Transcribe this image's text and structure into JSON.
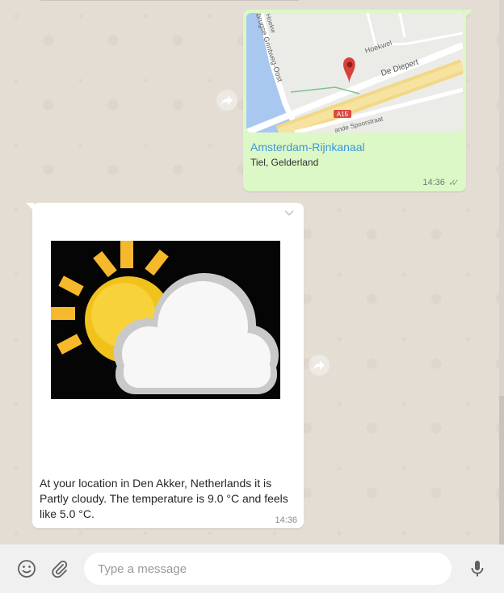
{
  "messages": {
    "location": {
      "name": "Amsterdam-Rijnkanaal",
      "subtitle": "Tiel, Gelderland",
      "time": "14:36",
      "map": {
        "road_hoekwel": "Hoekwel",
        "road_diepert": "De Diepert",
        "road_grintweg": "brugse Grintweg-Oost",
        "road_spoor": "ande Spoorstraat",
        "road_a15": "A15",
        "road_top": "Hoekw"
      }
    },
    "weather": {
      "caption": "At your location in Den Akker, Netherlands it is Partly cloudy. The temperature is 9.0 °C and feels like 5.0 °C.",
      "time": "14:36"
    }
  },
  "composer": {
    "placeholder": "Type a message"
  },
  "icons": {
    "emoji": "smiley-icon",
    "attach": "paperclip-icon",
    "mic": "microphone-icon",
    "forward": "forward-arrow-icon",
    "menu": "chevron-down-icon",
    "ticks": "double-check-icon"
  },
  "colors": {
    "outgoing": "#dcf8c6",
    "incoming": "#ffffff",
    "link": "#3e97d8",
    "chat_bg": "#e4ddd4",
    "composer_bg": "#f0f0f0"
  }
}
